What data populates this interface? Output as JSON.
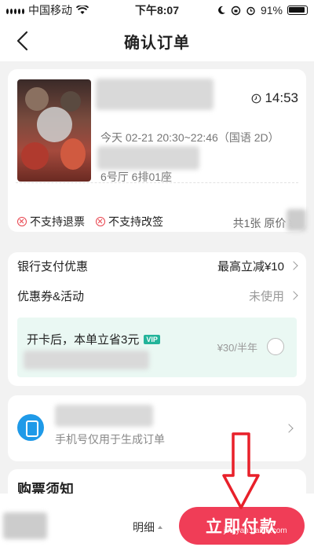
{
  "status_bar": {
    "carrier": "中国移动",
    "time": "下午8:07",
    "battery": "91%"
  },
  "nav": {
    "title": "确认订单"
  },
  "movie": {
    "showtime": "14:53",
    "schedule": "今天 02-21 20:30~22:46（国语 2D）",
    "seat": "6号厅 6排01座",
    "restrictions": [
      "不支持退票",
      "不支持改签"
    ],
    "ticket_summary": "共1张 原价 ¥"
  },
  "discounts": {
    "bank_label": "银行支付优惠",
    "bank_value": "最高立减¥10",
    "coupon_label": "优惠券&活动",
    "coupon_value": "未使用",
    "vip_text": "开卡后，本单立省3元",
    "vip_badge": "VIP",
    "vip_price": "¥30/半年"
  },
  "phone": {
    "note": "手机号仅用于生成订单"
  },
  "notice": {
    "title": "购票须知"
  },
  "bottom": {
    "detail_label": "明细",
    "pay_label": "立即付款"
  },
  "watermark": "jingyan.baidu.com",
  "colors": {
    "accent": "#f03d57",
    "vip_bg": "#eaf8f3",
    "phone_icon": "#1f9ae8",
    "annotation": "#e8202a"
  }
}
